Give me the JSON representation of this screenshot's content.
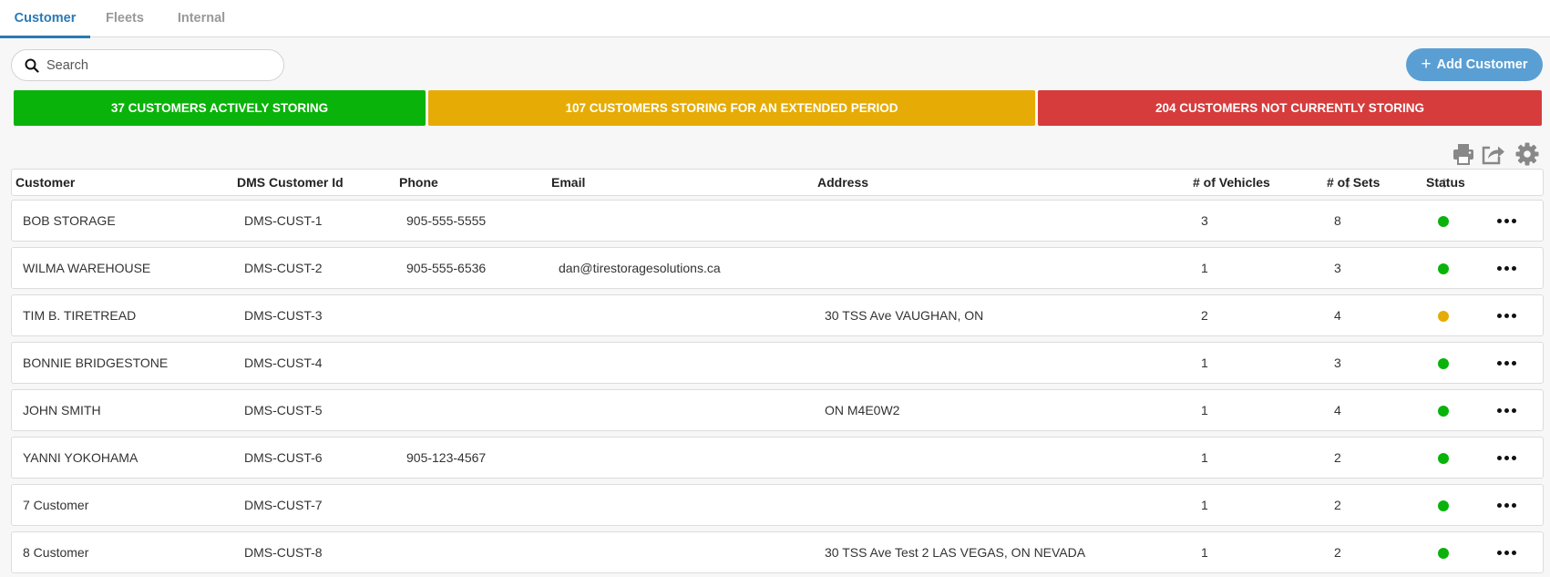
{
  "tabs": [
    {
      "label": "Customer",
      "active": true
    },
    {
      "label": "Fleets",
      "active": false
    },
    {
      "label": "Internal",
      "active": false
    }
  ],
  "search": {
    "placeholder": "Search",
    "value": ""
  },
  "add_button": {
    "label": "Add Customer"
  },
  "banners": {
    "active": "37 CUSTOMERS ACTIVELY STORING",
    "extended": "107 CUSTOMERS STORING FOR AN EXTENDED PERIOD",
    "not_storing": "204 CUSTOMERS NOT CURRENTLY STORING"
  },
  "colors": {
    "accent": "#2a7ab5",
    "button": "#5a9fd4",
    "green": "#0ab30a",
    "yellow": "#e6ac05",
    "red": "#d63c3c"
  },
  "toolbar": {
    "icons": [
      "print-icon",
      "share-icon",
      "gear-icon"
    ]
  },
  "table": {
    "columns": {
      "customer": "Customer",
      "dms_id": "DMS Customer Id",
      "phone": "Phone",
      "email": "Email",
      "address": "Address",
      "vehicles": "# of Vehicles",
      "sets": "# of Sets",
      "status": "Status"
    },
    "rows": [
      {
        "customer": "BOB STORAGE",
        "dms_id": "DMS-CUST-1",
        "phone": "905-555-5555",
        "email": "",
        "address": "",
        "vehicles": "3",
        "sets": "8",
        "status": "green"
      },
      {
        "customer": "WILMA WAREHOUSE",
        "dms_id": "DMS-CUST-2",
        "phone": "905-555-6536",
        "email": "dan@tirestoragesolutions.ca",
        "address": "",
        "vehicles": "1",
        "sets": "3",
        "status": "green"
      },
      {
        "customer": "TIM B. TIRETREAD",
        "dms_id": "DMS-CUST-3",
        "phone": "",
        "email": "",
        "address": "30 TSS Ave VAUGHAN, ON",
        "vehicles": "2",
        "sets": "4",
        "status": "yellow"
      },
      {
        "customer": "BONNIE BRIDGESTONE",
        "dms_id": "DMS-CUST-4",
        "phone": "",
        "email": "",
        "address": "",
        "vehicles": "1",
        "sets": "3",
        "status": "green"
      },
      {
        "customer": "JOHN SMITH",
        "dms_id": "DMS-CUST-5",
        "phone": "",
        "email": "",
        "address": "ON M4E0W2",
        "vehicles": "1",
        "sets": "4",
        "status": "green"
      },
      {
        "customer": "YANNI YOKOHAMA",
        "dms_id": "DMS-CUST-6",
        "phone": "905-123-4567",
        "email": "",
        "address": "",
        "vehicles": "1",
        "sets": "2",
        "status": "green"
      },
      {
        "customer": "7 Customer",
        "dms_id": "DMS-CUST-7",
        "phone": "",
        "email": "",
        "address": "",
        "vehicles": "1",
        "sets": "2",
        "status": "green"
      },
      {
        "customer": "8 Customer",
        "dms_id": "DMS-CUST-8",
        "phone": "",
        "email": "",
        "address": "30 TSS Ave Test 2 LAS VEGAS, ON NEVADA",
        "vehicles": "1",
        "sets": "2",
        "status": "green"
      }
    ]
  }
}
